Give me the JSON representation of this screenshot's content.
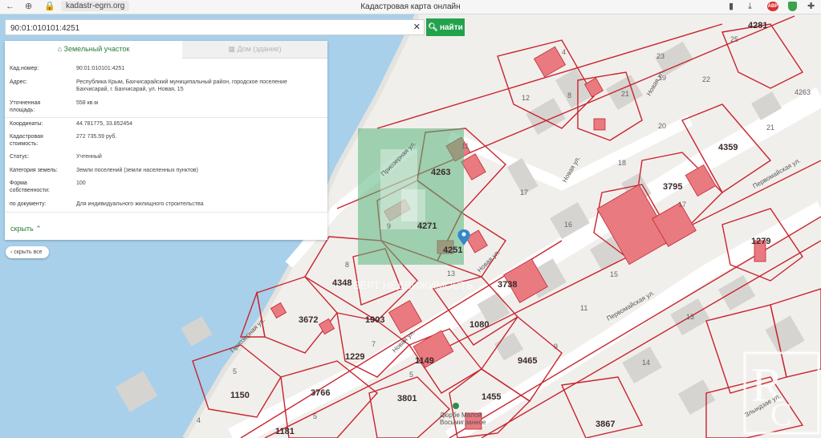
{
  "browser": {
    "url": "kadastr-egrn.org",
    "title": "Кадастровая карта онлайн",
    "adblock_badge": "ABP"
  },
  "search": {
    "value": "90:01:010101:4251",
    "clear_icon": "✕",
    "button_label": "найти"
  },
  "panel": {
    "tab_land": "Земельный участок",
    "tab_house": "Дом (здание)",
    "fields": [
      {
        "key": "Кад.номер:",
        "value": "90:01:010101:4251"
      },
      {
        "key": "Адрес:",
        "value": "Республика Крым, Бахчисарайский муниципальный район, городское поселение Бахчисарай, г. Бахчисарай, ул. Новая, 15"
      },
      {
        "key": "Уточненная площадь:",
        "value": "558 кв.м"
      },
      {
        "key": "Координаты:",
        "value": "44.781775, 33.852454"
      },
      {
        "key": "Кадастровая стоимость:",
        "value": "272 735.59 руб."
      },
      {
        "key": "Статус:",
        "value": "Учтенный"
      },
      {
        "key": "Категория земель:",
        "value": "Земли поселений (земли населенных пунктов)"
      },
      {
        "key": "Форма собственности:",
        "value": "100"
      },
      {
        "key": "по документу:",
        "value": "Для индивидуального жилищного строительства"
      }
    ],
    "hide_label": "скрыть",
    "hide_all_label": "скрыть все"
  },
  "map": {
    "streets": [
      "Новая ул.",
      "Новая ул.",
      "Новая ул.",
      "Новая ул.",
      "Приозерная ул.",
      "Приозерная ул.",
      "Первомайская ул.",
      "Первомайская ул.",
      "Злындзае ул."
    ],
    "plots": [
      "4263",
      "4271",
      "4251",
      "4348",
      "3672",
      "1903",
      "1229",
      "1080",
      "1149",
      "3766",
      "1150",
      "1181",
      "3801",
      "1455",
      "3867",
      "9465",
      "3738",
      "4359",
      "3795",
      "4281",
      "1279"
    ],
    "poi": "Дюрбе Малой Восьмигранное",
    "watermark_text": "ВЕРТ НЕДВИЖИМОСТЬ"
  }
}
